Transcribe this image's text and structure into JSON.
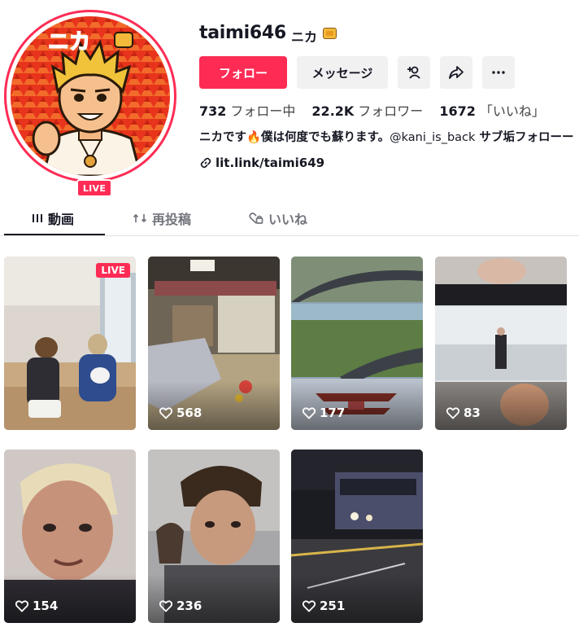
{
  "profile": {
    "username": "taimi646",
    "nickname": "ニカ",
    "nickname_emoji": "bread-emoji",
    "live_badge": "LIVE",
    "avatar_text": "ニカ"
  },
  "actions": {
    "follow_label": "フォロー",
    "message_label": "メッセージ",
    "add_friend_icon": "add-user-icon",
    "share_icon": "share-icon",
    "more_icon": "more-icon"
  },
  "stats": {
    "following_count": "732",
    "following_label": "フォロー中",
    "followers_count": "22.2K",
    "followers_label": "フォロワー",
    "likes_count": "1672",
    "likes_label": "「いいね」"
  },
  "bio": {
    "text_before": "ニカです🔥僕は何度でも蘇ります。",
    "mention": "@kani_is_back",
    "text_after": " サブ垢フォローー",
    "link": "lit.link/taimi649"
  },
  "tabs": [
    {
      "label": "動画",
      "active": true
    },
    {
      "label": "再投稿",
      "active": false
    },
    {
      "label": "いいね",
      "active": false
    }
  ],
  "videos": [
    {
      "views": "",
      "live_label": "LIVE"
    },
    {
      "views": "568"
    },
    {
      "views": "177"
    },
    {
      "views": "83"
    },
    {
      "views": "154"
    },
    {
      "views": "236"
    },
    {
      "views": "251"
    }
  ],
  "colors": {
    "accent": "#fe2c55",
    "button_bg": "#f1f1f2",
    "text": "#161823"
  }
}
